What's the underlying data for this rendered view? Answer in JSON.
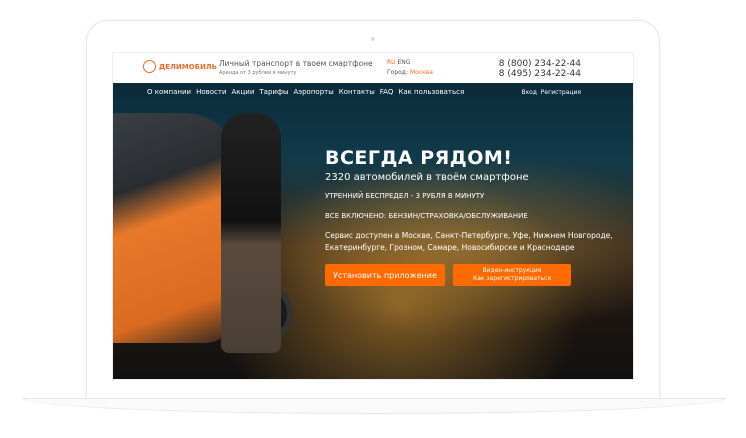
{
  "header": {
    "logo": "ДЕЛИМОБИЛЬ",
    "tagline": "Личный транспорт в твоем смартфоне",
    "tagline_sub": "Аренда от 3 рублей в минуту",
    "lang_ru": "RU",
    "lang_en": "ENG",
    "city_label": "Город:",
    "city": "Москва",
    "phone1": "8 (800) 234-22-44",
    "phone2": "8 (495) 234-22-44"
  },
  "nav": {
    "items": [
      "О компании",
      "Новости",
      "Акции",
      "Тарифы",
      "Аэропорты",
      "Контакты",
      "FAQ",
      "Как пользоваться"
    ],
    "login": "Вход",
    "register": "Регистрация"
  },
  "hero": {
    "title": "ВСЕГДА РЯДОМ!",
    "subtitle": "2320 автомобилей в твоём смартфоне",
    "line1": "УТРЕННИЙ БЕСПРЕДЕЛ - 3 РУБЛЯ В МИНУТУ",
    "line2": "ВСЕ ВКЛЮЧЕНО: БЕНЗИН/СТРАХОВКА/ОБСЛУЖИВАНИЕ",
    "description": "Сервис доступен в Москве, Санкт-Петербурге, Уфе, Нижнем Новгороде, Екатеринбурге, Грозном, Самаре, Новосибирске и Краснодаре",
    "install_button": "Установить приложение",
    "video_line1": "Видео-инструкция",
    "video_line2": "Как зарегистрироваться"
  },
  "colors": {
    "accent": "#ff6a00"
  }
}
